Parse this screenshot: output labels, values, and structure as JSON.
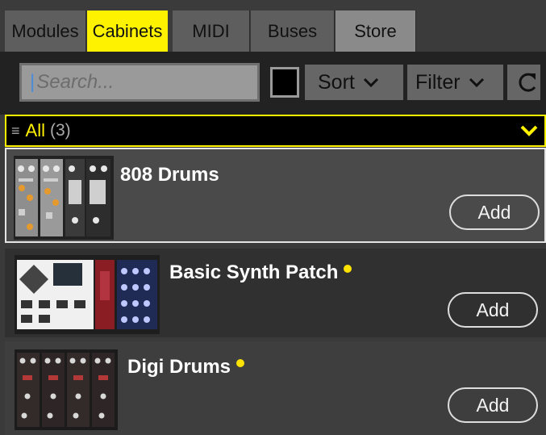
{
  "tabs": [
    {
      "label": "Modules",
      "active": false
    },
    {
      "label": "Cabinets",
      "active": true
    },
    {
      "label": "MIDI",
      "active": false
    },
    {
      "label": "Buses",
      "active": false
    },
    {
      "label": "Store",
      "active": false
    }
  ],
  "toolbar": {
    "search_placeholder": "Search...",
    "sort_label": "Sort",
    "filter_label": "Filter",
    "refresh_icon": "refresh-icon",
    "color_swatch": "#000000"
  },
  "filter_bar": {
    "label": "All",
    "count": "(3)",
    "menu_icon": "menu-icon",
    "expand_icon": "chevron-down-icon"
  },
  "items": [
    {
      "title": "808 Drums",
      "new": false,
      "add_label": "Add"
    },
    {
      "title": "Basic Synth Patch",
      "new": true,
      "add_label": "Add"
    },
    {
      "title": "Digi Drums",
      "new": true,
      "add_label": "Add"
    }
  ],
  "colors": {
    "accent": "#fff200",
    "new_dot": "#ffe300",
    "panel_bg": "#222222"
  }
}
